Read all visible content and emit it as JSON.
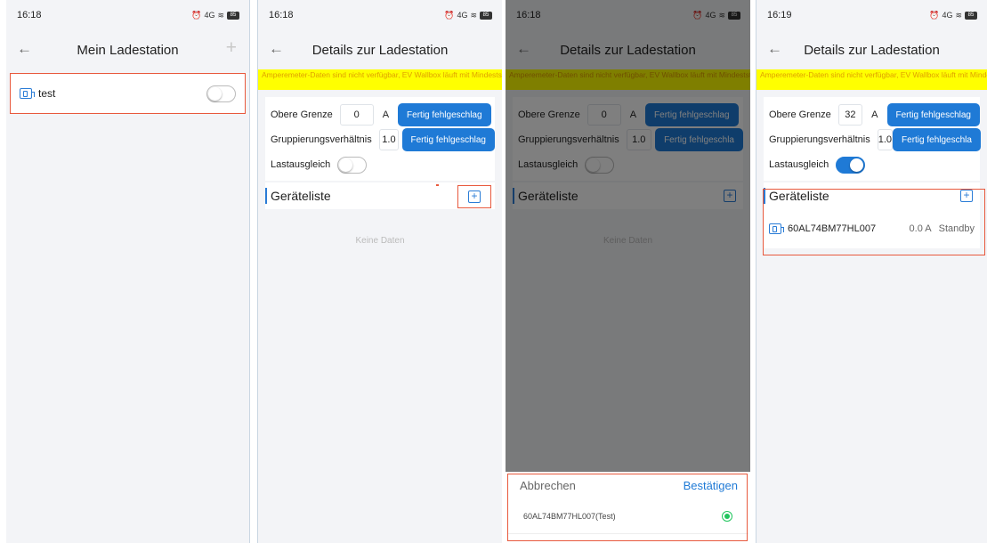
{
  "screen1": {
    "time": "16:18",
    "title": "Mein Ladestation",
    "item_label": "test",
    "item_enabled": false
  },
  "screen2": {
    "time": "16:18",
    "title": "Details zur Ladestation",
    "warning": "Amperemeter-Daten sind nicht verfügbar, EV Wallbox läuft mit Mindeststrom",
    "upper_limit_label": "Obere Grenze",
    "upper_limit_value": "0",
    "unit": "A",
    "button_label": "Fertig fehlgeschlag",
    "ratio_label": "Gruppierungsverhältnis",
    "ratio_value": "1.0",
    "button_label_2": "Fertig fehlgeschlag",
    "load_balance_label": "Lastausgleich",
    "load_balance_on": false,
    "device_list_title": "Geräteliste",
    "empty_text": "Keine Daten"
  },
  "screen3": {
    "time": "16:18",
    "title": "Details zur Ladestation",
    "warning": "Amperemeter-Daten sind nicht verfügbar, EV Wallbox läuft mit Mindeststrom",
    "upper_limit_label": "Obere Grenze",
    "upper_limit_value": "0",
    "unit": "A",
    "button_label": "Fertig fehlgeschlag",
    "ratio_label": "Gruppierungsverhältnis",
    "ratio_value": "1.0",
    "button_label_2": "Fertig fehlgeschla",
    "load_balance_label": "Lastausgleich",
    "device_list_title": "Geräteliste",
    "empty_text": "Keine Daten",
    "sheet_cancel": "Abbrechen",
    "sheet_confirm": "Bestätigen",
    "sheet_item": "60AL74BM77HL007(Test)",
    "sheet_item_selected": true
  },
  "screen4": {
    "time": "16:19",
    "title": "Details zur Ladestation",
    "warning": "Amperemeter-Daten sind nicht verfügbar, EV Wallbox läuft mit Mindeststrom",
    "upper_limit_label": "Obere Grenze",
    "upper_limit_value": "32",
    "unit": "A",
    "button_label": "Fertig fehlgeschlag",
    "ratio_label": "Gruppierungsverhältnis",
    "ratio_value": "1.0",
    "button_label_2": "Fertig fehlgeschla",
    "load_balance_label": "Lastausgleich",
    "load_balance_on": true,
    "device_list_title": "Geräteliste",
    "device_id": "60AL74BM77HL007",
    "device_current": "0.0 A",
    "device_status": "Standby"
  },
  "status_icons": {
    "alarm": "alarm-icon",
    "signal_text": "4G",
    "battery": "85"
  },
  "colors": {
    "accent": "#1f7ad6",
    "highlight": "#e8593d",
    "warning_bg": "#ffff00",
    "warning_text": "#e0a000",
    "selected": "#22c55e"
  }
}
